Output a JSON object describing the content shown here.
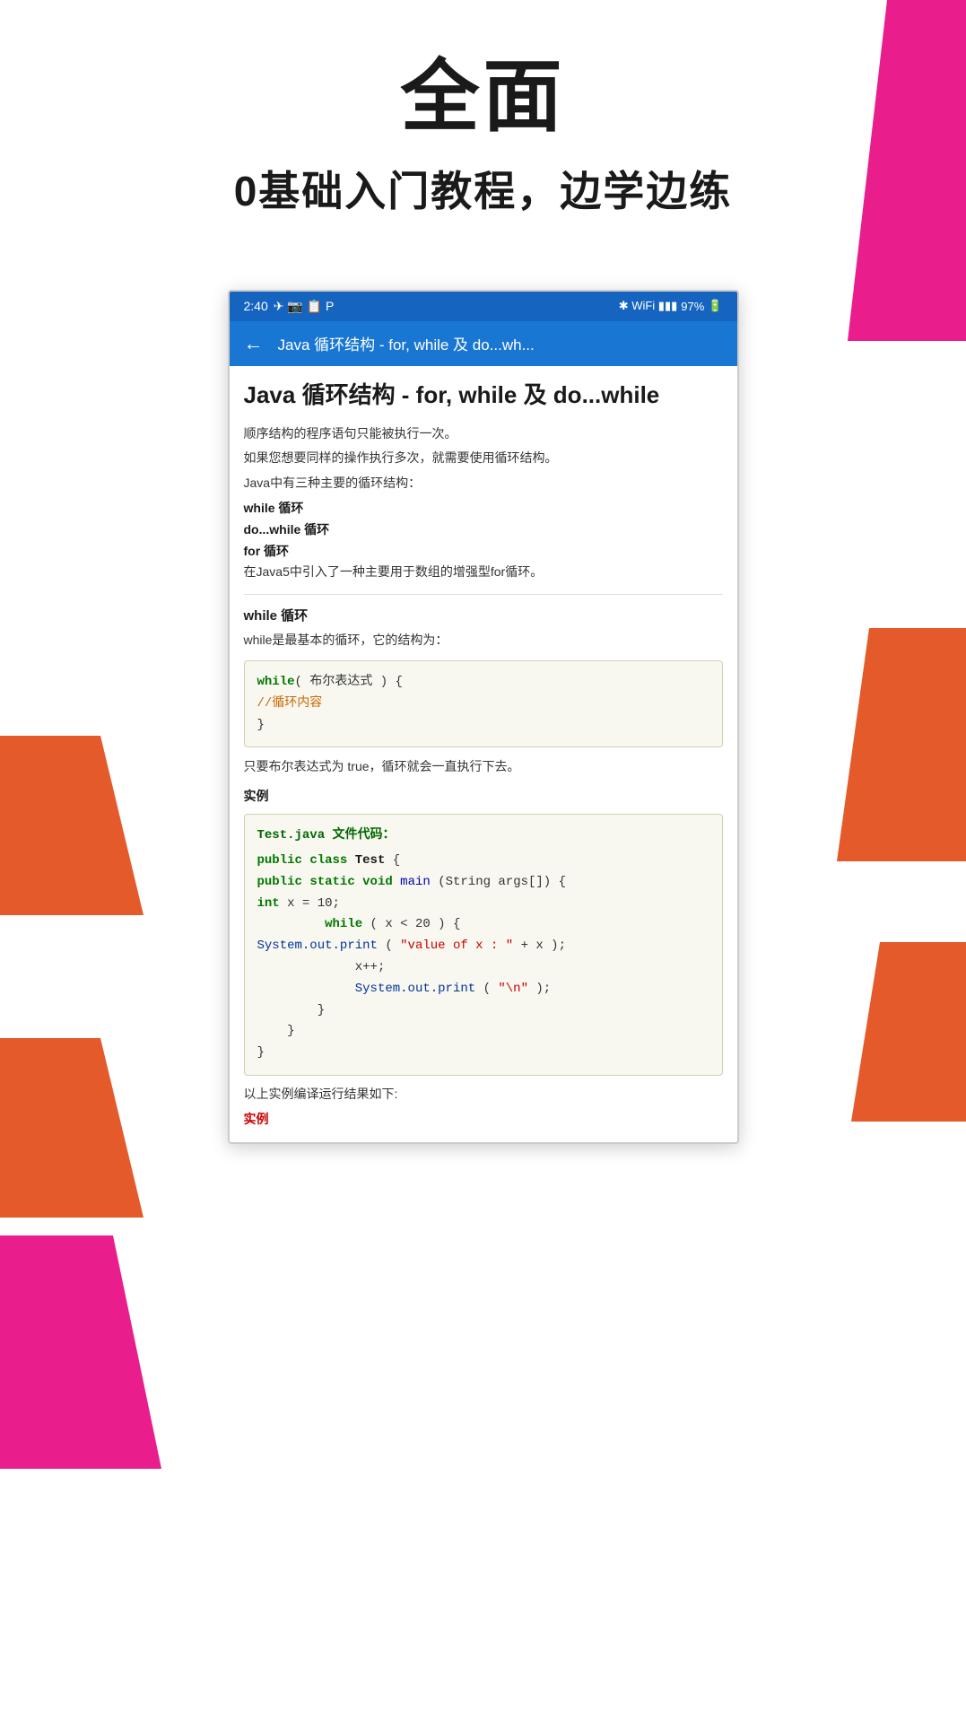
{
  "header": {
    "main_title": "全面",
    "subtitle": "0基础入门教程，边学边练"
  },
  "status_bar": {
    "time": "2:40",
    "battery": "97%",
    "icons_left": "✈ 📱 🔖 P",
    "icons_right": "✱ 🔊 97%"
  },
  "toolbar": {
    "back_icon": "←",
    "title": "Java 循环结构 - for, while 及 do...wh..."
  },
  "article": {
    "title": "Java 循环结构 - for, while 及 do...while",
    "intro_lines": [
      "顺序结构的程序语句只能被执行一次。",
      "如果您想要同样的操作执行多次，就需要使用循环结构。",
      "Java中有三种主要的循环结构："
    ],
    "loop_types": [
      "while 循环",
      "do...while 循环",
      "for 循环"
    ],
    "enhanced_for_note": "在Java5中引入了一种主要用于数组的增强型for循环。",
    "while_section": {
      "heading": "while 循环",
      "description": "while是最基本的循环，它的结构为：",
      "code": {
        "line1": "while( 布尔表达式 ) {",
        "line2": "//循环内容",
        "line3": "}"
      }
    },
    "while_note": "只要布尔表达式为 true，循环就会一直执行下去。",
    "example_label": "实例",
    "file_label": "Test.java 文件代码：",
    "code_block": {
      "line1": "public class Test {",
      "line2": "public static void main(String args[]) {",
      "line3": "int x = 10;",
      "line4": "        while( x < 20 ) {",
      "line5": "System.out.print(\"value of x : \" + x );",
      "line6": "            x++;",
      "line7": "            System.out.print(\"\\n\");",
      "line8": "        }",
      "line9": "    }",
      "line10": "}"
    },
    "result_text": "以上实例编译运行结果如下:",
    "result_example_label": "实例"
  },
  "decorative": {
    "colors": {
      "pink": "#e91e8c",
      "orange": "#e55a2b",
      "blue": "#1976d2"
    }
  }
}
